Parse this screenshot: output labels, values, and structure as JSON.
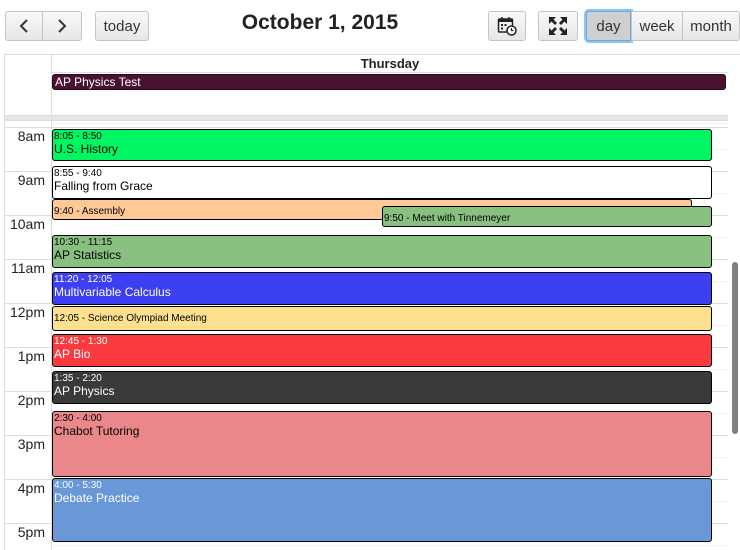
{
  "toolbar": {
    "prev_icon": "chevron-left-icon",
    "next_icon": "chevron-right-icon",
    "today_label": "today",
    "calendar_icon": "calendar-clock-icon",
    "fullscreen_icon": "fullscreen-icon",
    "views": [
      {
        "label": "day",
        "active": true
      },
      {
        "label": "week",
        "active": false
      },
      {
        "label": "month",
        "active": false
      }
    ]
  },
  "title": "October 1, 2015",
  "day_header": "Thursday",
  "all_day_events": [
    {
      "name": "AP Physics Test",
      "color": "#4a1232"
    }
  ],
  "time_axis": [
    "8am",
    "9am",
    "10am",
    "11am",
    "12pm",
    "1pm",
    "2pm",
    "3pm",
    "4pm",
    "5pm"
  ],
  "events": [
    {
      "time": "8:05 - 8:50",
      "name": "U.S. History",
      "color": "#00f562",
      "text_color": "#000000"
    },
    {
      "time": "8:55 - 9:40",
      "name": "Falling from Grace",
      "color": "#ffffff",
      "text_color": "#000000"
    },
    {
      "time": "9:40 - ",
      "name": "Assembly",
      "color": "#ffc896",
      "text_color": "#000000"
    },
    {
      "time": "9:50 - ",
      "name": "Meet with Tinnemeyer",
      "color": "#88c07f",
      "text_color": "#000000"
    },
    {
      "time": "10:30 - 11:15",
      "name": "AP Statistics",
      "color": "#88c07f",
      "text_color": "#000000"
    },
    {
      "time": "11:20 - 12:05",
      "name": "Multivariable Calculus",
      "color": "#3d3ff2",
      "text_color": "#ffffff"
    },
    {
      "time": "12:05 - ",
      "name": "Science Olympiad Meeting",
      "color": "#ffe08e",
      "text_color": "#000000"
    },
    {
      "time": "12:45 - 1:30",
      "name": "AP Bio",
      "color": "#fb3a40",
      "text_color": "#ffffff"
    },
    {
      "time": "1:35 - 2:20",
      "name": "AP Physics",
      "color": "#3a3a3a",
      "text_color": "#ffffff"
    },
    {
      "time": "2:30 - 4:00",
      "name": "Chabot Tutoring",
      "color": "#e9878a",
      "text_color": "#000000"
    },
    {
      "time": "4:00 - 5:30",
      "name": "Debate Practice",
      "color": "#6997d8",
      "text_color": "#ffffff"
    }
  ]
}
